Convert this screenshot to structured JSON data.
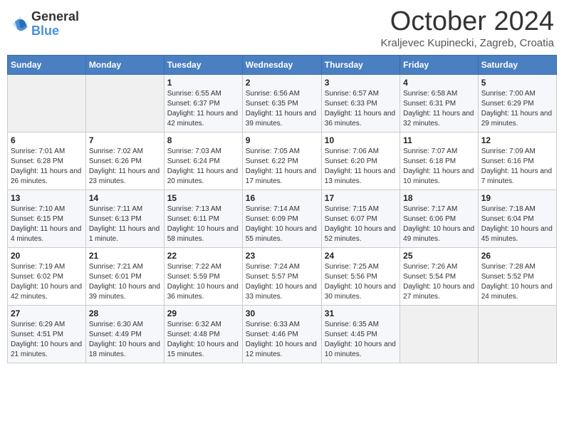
{
  "logo": {
    "general": "General",
    "blue": "Blue"
  },
  "title": "October 2024",
  "location": "Kraljevec Kupinecki, Zagreb, Croatia",
  "days_of_week": [
    "Sunday",
    "Monday",
    "Tuesday",
    "Wednesday",
    "Thursday",
    "Friday",
    "Saturday"
  ],
  "weeks": [
    [
      {
        "day": "",
        "sunrise": "",
        "sunset": "",
        "daylight": ""
      },
      {
        "day": "",
        "sunrise": "",
        "sunset": "",
        "daylight": ""
      },
      {
        "day": "1",
        "sunrise": "Sunrise: 6:55 AM",
        "sunset": "Sunset: 6:37 PM",
        "daylight": "Daylight: 11 hours and 42 minutes."
      },
      {
        "day": "2",
        "sunrise": "Sunrise: 6:56 AM",
        "sunset": "Sunset: 6:35 PM",
        "daylight": "Daylight: 11 hours and 39 minutes."
      },
      {
        "day": "3",
        "sunrise": "Sunrise: 6:57 AM",
        "sunset": "Sunset: 6:33 PM",
        "daylight": "Daylight: 11 hours and 36 minutes."
      },
      {
        "day": "4",
        "sunrise": "Sunrise: 6:58 AM",
        "sunset": "Sunset: 6:31 PM",
        "daylight": "Daylight: 11 hours and 32 minutes."
      },
      {
        "day": "5",
        "sunrise": "Sunrise: 7:00 AM",
        "sunset": "Sunset: 6:29 PM",
        "daylight": "Daylight: 11 hours and 29 minutes."
      }
    ],
    [
      {
        "day": "6",
        "sunrise": "Sunrise: 7:01 AM",
        "sunset": "Sunset: 6:28 PM",
        "daylight": "Daylight: 11 hours and 26 minutes."
      },
      {
        "day": "7",
        "sunrise": "Sunrise: 7:02 AM",
        "sunset": "Sunset: 6:26 PM",
        "daylight": "Daylight: 11 hours and 23 minutes."
      },
      {
        "day": "8",
        "sunrise": "Sunrise: 7:03 AM",
        "sunset": "Sunset: 6:24 PM",
        "daylight": "Daylight: 11 hours and 20 minutes."
      },
      {
        "day": "9",
        "sunrise": "Sunrise: 7:05 AM",
        "sunset": "Sunset: 6:22 PM",
        "daylight": "Daylight: 11 hours and 17 minutes."
      },
      {
        "day": "10",
        "sunrise": "Sunrise: 7:06 AM",
        "sunset": "Sunset: 6:20 PM",
        "daylight": "Daylight: 11 hours and 13 minutes."
      },
      {
        "day": "11",
        "sunrise": "Sunrise: 7:07 AM",
        "sunset": "Sunset: 6:18 PM",
        "daylight": "Daylight: 11 hours and 10 minutes."
      },
      {
        "day": "12",
        "sunrise": "Sunrise: 7:09 AM",
        "sunset": "Sunset: 6:16 PM",
        "daylight": "Daylight: 11 hours and 7 minutes."
      }
    ],
    [
      {
        "day": "13",
        "sunrise": "Sunrise: 7:10 AM",
        "sunset": "Sunset: 6:15 PM",
        "daylight": "Daylight: 11 hours and 4 minutes."
      },
      {
        "day": "14",
        "sunrise": "Sunrise: 7:11 AM",
        "sunset": "Sunset: 6:13 PM",
        "daylight": "Daylight: 11 hours and 1 minute."
      },
      {
        "day": "15",
        "sunrise": "Sunrise: 7:13 AM",
        "sunset": "Sunset: 6:11 PM",
        "daylight": "Daylight: 10 hours and 58 minutes."
      },
      {
        "day": "16",
        "sunrise": "Sunrise: 7:14 AM",
        "sunset": "Sunset: 6:09 PM",
        "daylight": "Daylight: 10 hours and 55 minutes."
      },
      {
        "day": "17",
        "sunrise": "Sunrise: 7:15 AM",
        "sunset": "Sunset: 6:07 PM",
        "daylight": "Daylight: 10 hours and 52 minutes."
      },
      {
        "day": "18",
        "sunrise": "Sunrise: 7:17 AM",
        "sunset": "Sunset: 6:06 PM",
        "daylight": "Daylight: 10 hours and 49 minutes."
      },
      {
        "day": "19",
        "sunrise": "Sunrise: 7:18 AM",
        "sunset": "Sunset: 6:04 PM",
        "daylight": "Daylight: 10 hours and 45 minutes."
      }
    ],
    [
      {
        "day": "20",
        "sunrise": "Sunrise: 7:19 AM",
        "sunset": "Sunset: 6:02 PM",
        "daylight": "Daylight: 10 hours and 42 minutes."
      },
      {
        "day": "21",
        "sunrise": "Sunrise: 7:21 AM",
        "sunset": "Sunset: 6:01 PM",
        "daylight": "Daylight: 10 hours and 39 minutes."
      },
      {
        "day": "22",
        "sunrise": "Sunrise: 7:22 AM",
        "sunset": "Sunset: 5:59 PM",
        "daylight": "Daylight: 10 hours and 36 minutes."
      },
      {
        "day": "23",
        "sunrise": "Sunrise: 7:24 AM",
        "sunset": "Sunset: 5:57 PM",
        "daylight": "Daylight: 10 hours and 33 minutes."
      },
      {
        "day": "24",
        "sunrise": "Sunrise: 7:25 AM",
        "sunset": "Sunset: 5:56 PM",
        "daylight": "Daylight: 10 hours and 30 minutes."
      },
      {
        "day": "25",
        "sunrise": "Sunrise: 7:26 AM",
        "sunset": "Sunset: 5:54 PM",
        "daylight": "Daylight: 10 hours and 27 minutes."
      },
      {
        "day": "26",
        "sunrise": "Sunrise: 7:28 AM",
        "sunset": "Sunset: 5:52 PM",
        "daylight": "Daylight: 10 hours and 24 minutes."
      }
    ],
    [
      {
        "day": "27",
        "sunrise": "Sunrise: 6:29 AM",
        "sunset": "Sunset: 4:51 PM",
        "daylight": "Daylight: 10 hours and 21 minutes."
      },
      {
        "day": "28",
        "sunrise": "Sunrise: 6:30 AM",
        "sunset": "Sunset: 4:49 PM",
        "daylight": "Daylight: 10 hours and 18 minutes."
      },
      {
        "day": "29",
        "sunrise": "Sunrise: 6:32 AM",
        "sunset": "Sunset: 4:48 PM",
        "daylight": "Daylight: 10 hours and 15 minutes."
      },
      {
        "day": "30",
        "sunrise": "Sunrise: 6:33 AM",
        "sunset": "Sunset: 4:46 PM",
        "daylight": "Daylight: 10 hours and 12 minutes."
      },
      {
        "day": "31",
        "sunrise": "Sunrise: 6:35 AM",
        "sunset": "Sunset: 4:45 PM",
        "daylight": "Daylight: 10 hours and 10 minutes."
      },
      {
        "day": "",
        "sunrise": "",
        "sunset": "",
        "daylight": ""
      },
      {
        "day": "",
        "sunrise": "",
        "sunset": "",
        "daylight": ""
      }
    ]
  ]
}
